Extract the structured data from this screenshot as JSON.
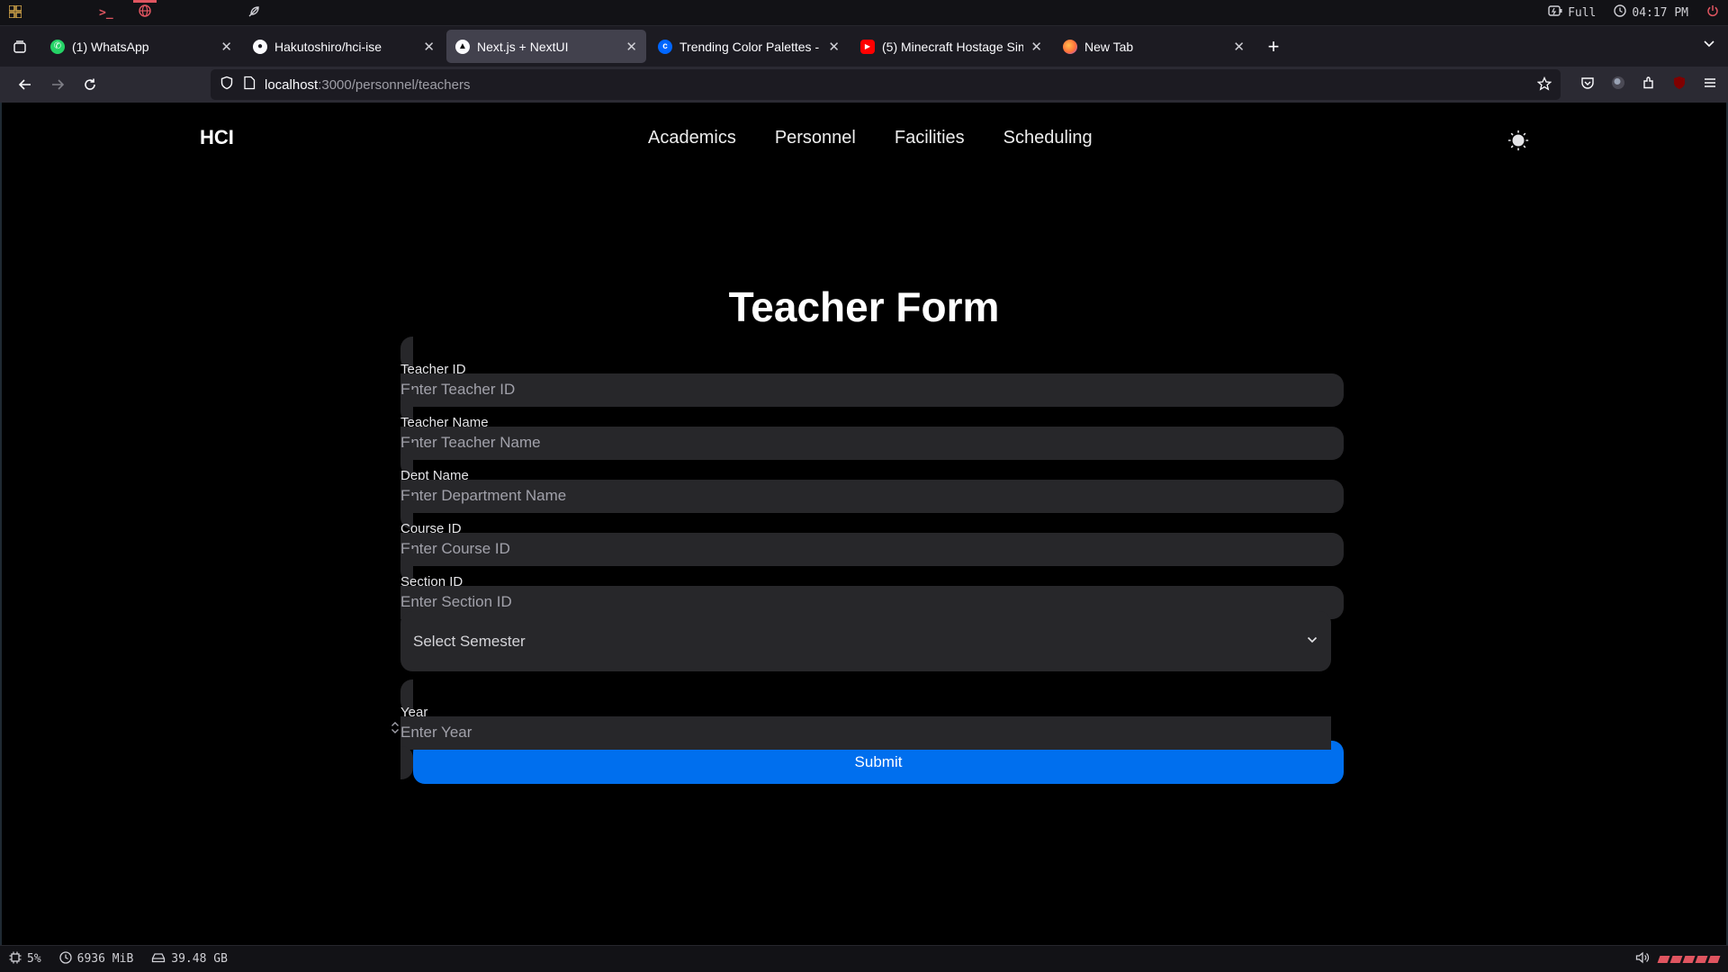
{
  "system_bar": {
    "battery_mode": "Full",
    "clock": "04:17 PM"
  },
  "tabs": [
    {
      "title": "(1) WhatsApp",
      "icon": "whatsapp-icon",
      "active": false
    },
    {
      "title": "Hakutoshiro/hci-ise",
      "icon": "github-icon",
      "active": false
    },
    {
      "title": "Next.js + NextUI",
      "icon": "nextjs-icon",
      "active": true
    },
    {
      "title": "Trending Color Palettes - C",
      "icon": "coolors-icon",
      "active": false
    },
    {
      "title": "(5) Minecraft Hostage Simu",
      "icon": "youtube-icon",
      "active": false
    },
    {
      "title": "New Tab",
      "icon": "firefox-icon",
      "active": false
    }
  ],
  "address_bar": {
    "host": "localhost",
    "path": ":3000/personnel/teachers"
  },
  "site": {
    "brand": "HCI",
    "nav_links": [
      "Academics",
      "Personnel",
      "Facilities",
      "Scheduling"
    ]
  },
  "form": {
    "title": "Teacher Form",
    "fields": {
      "teacher_id": {
        "label": "Teacher ID",
        "placeholder": "Enter Teacher ID"
      },
      "teacher_name": {
        "label": "Teacher Name",
        "placeholder": "Enter Teacher Name"
      },
      "dept_name": {
        "label": "Dept Name",
        "placeholder": "Enter Department Name"
      },
      "course_id": {
        "label": "Course ID",
        "placeholder": "Enter Course ID"
      },
      "section_id": {
        "label": "Section ID",
        "placeholder": "Enter Section ID"
      },
      "semester": {
        "placeholder": "Select Semester"
      },
      "year": {
        "label": "Year",
        "placeholder": "Enter Year"
      }
    },
    "submit_label": "Submit"
  },
  "status_bar": {
    "cpu": "5%",
    "memory": "6936 MiB",
    "disk": "39.48 GB"
  },
  "colors": {
    "accent": "#006fee",
    "field_bg": "#27272a",
    "workspace_active": "#e05560"
  }
}
